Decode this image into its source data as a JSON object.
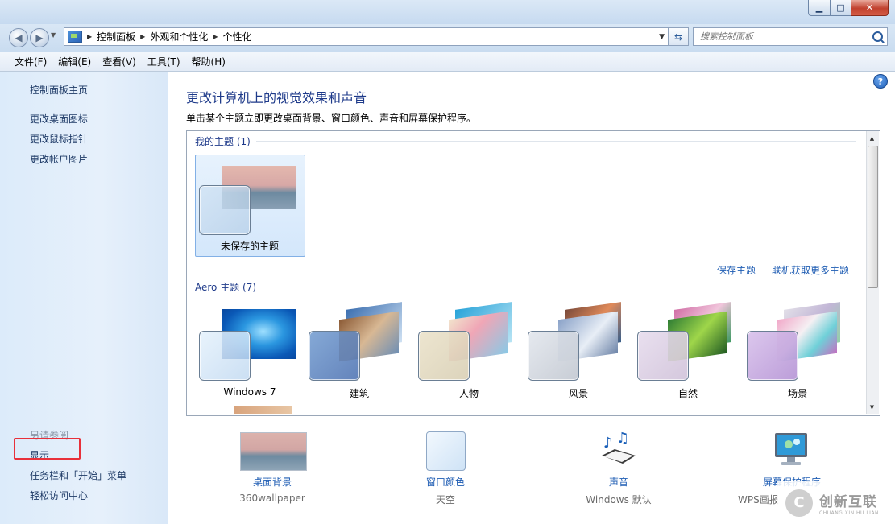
{
  "address": {
    "crumbs": [
      "控制面板",
      "外观和个性化",
      "个性化"
    ]
  },
  "search": {
    "placeholder": "搜索控制面板"
  },
  "menu": [
    "文件(F)",
    "编辑(E)",
    "查看(V)",
    "工具(T)",
    "帮助(H)"
  ],
  "sidebar": {
    "home": "控制面板主页",
    "links": [
      "更改桌面图标",
      "更改鼠标指针",
      "更改帐户图片"
    ],
    "see_also_title": "另请参阅",
    "see_also": [
      "显示",
      "任务栏和「开始」菜单",
      "轻松访问中心"
    ]
  },
  "main": {
    "title": "更改计算机上的视觉效果和声音",
    "description": "单击某个主题立即更改桌面背景、窗口颜色、声音和屏幕保护程序。",
    "my_themes_title": "我的主题 (1)",
    "unsaved_theme": "未保存的主题",
    "save_theme": "保存主题",
    "get_more": "联机获取更多主题",
    "aero_title": "Aero 主题 (7)",
    "aero_themes": [
      "Windows 7",
      "建筑",
      "人物",
      "风景",
      "自然",
      "场景"
    ]
  },
  "options": [
    {
      "label": "桌面背景",
      "value": "360wallpaper"
    },
    {
      "label": "窗口颜色",
      "value": "天空"
    },
    {
      "label": "声音",
      "value": "Windows 默认"
    },
    {
      "label": "屏幕保护程序",
      "value": "WPS画报"
    }
  ],
  "watermark": {
    "text": "创新互联",
    "sub": "CHUANG XIN HU LIAN"
  }
}
